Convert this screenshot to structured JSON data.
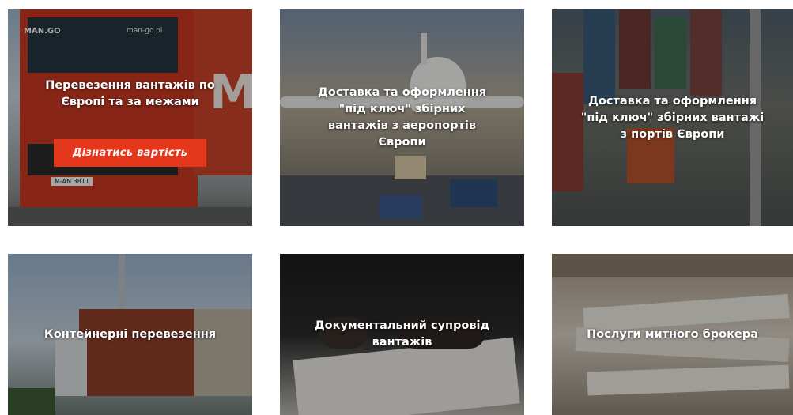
{
  "cards": [
    {
      "title": "Перевезення вантажів по Європі та за межами",
      "button_label": "Дізнатись вартість"
    },
    {
      "title": "Доставка та оформлення \"під ключ\" збірних вантажів з аеропортів Європи"
    },
    {
      "title": "Доставка та оформлення \"під ключ\" збірних вантажі з портів Європи"
    },
    {
      "title": "Контейнерні перевезення"
    },
    {
      "title": "Документальний супровід вантажів"
    },
    {
      "title": "Послуги митного брокера"
    }
  ],
  "brand": {
    "truck_logo": "MAN.GO",
    "truck_site": "man-go.pl",
    "plate": "M-AN 3811",
    "accent": "#e4371c"
  }
}
